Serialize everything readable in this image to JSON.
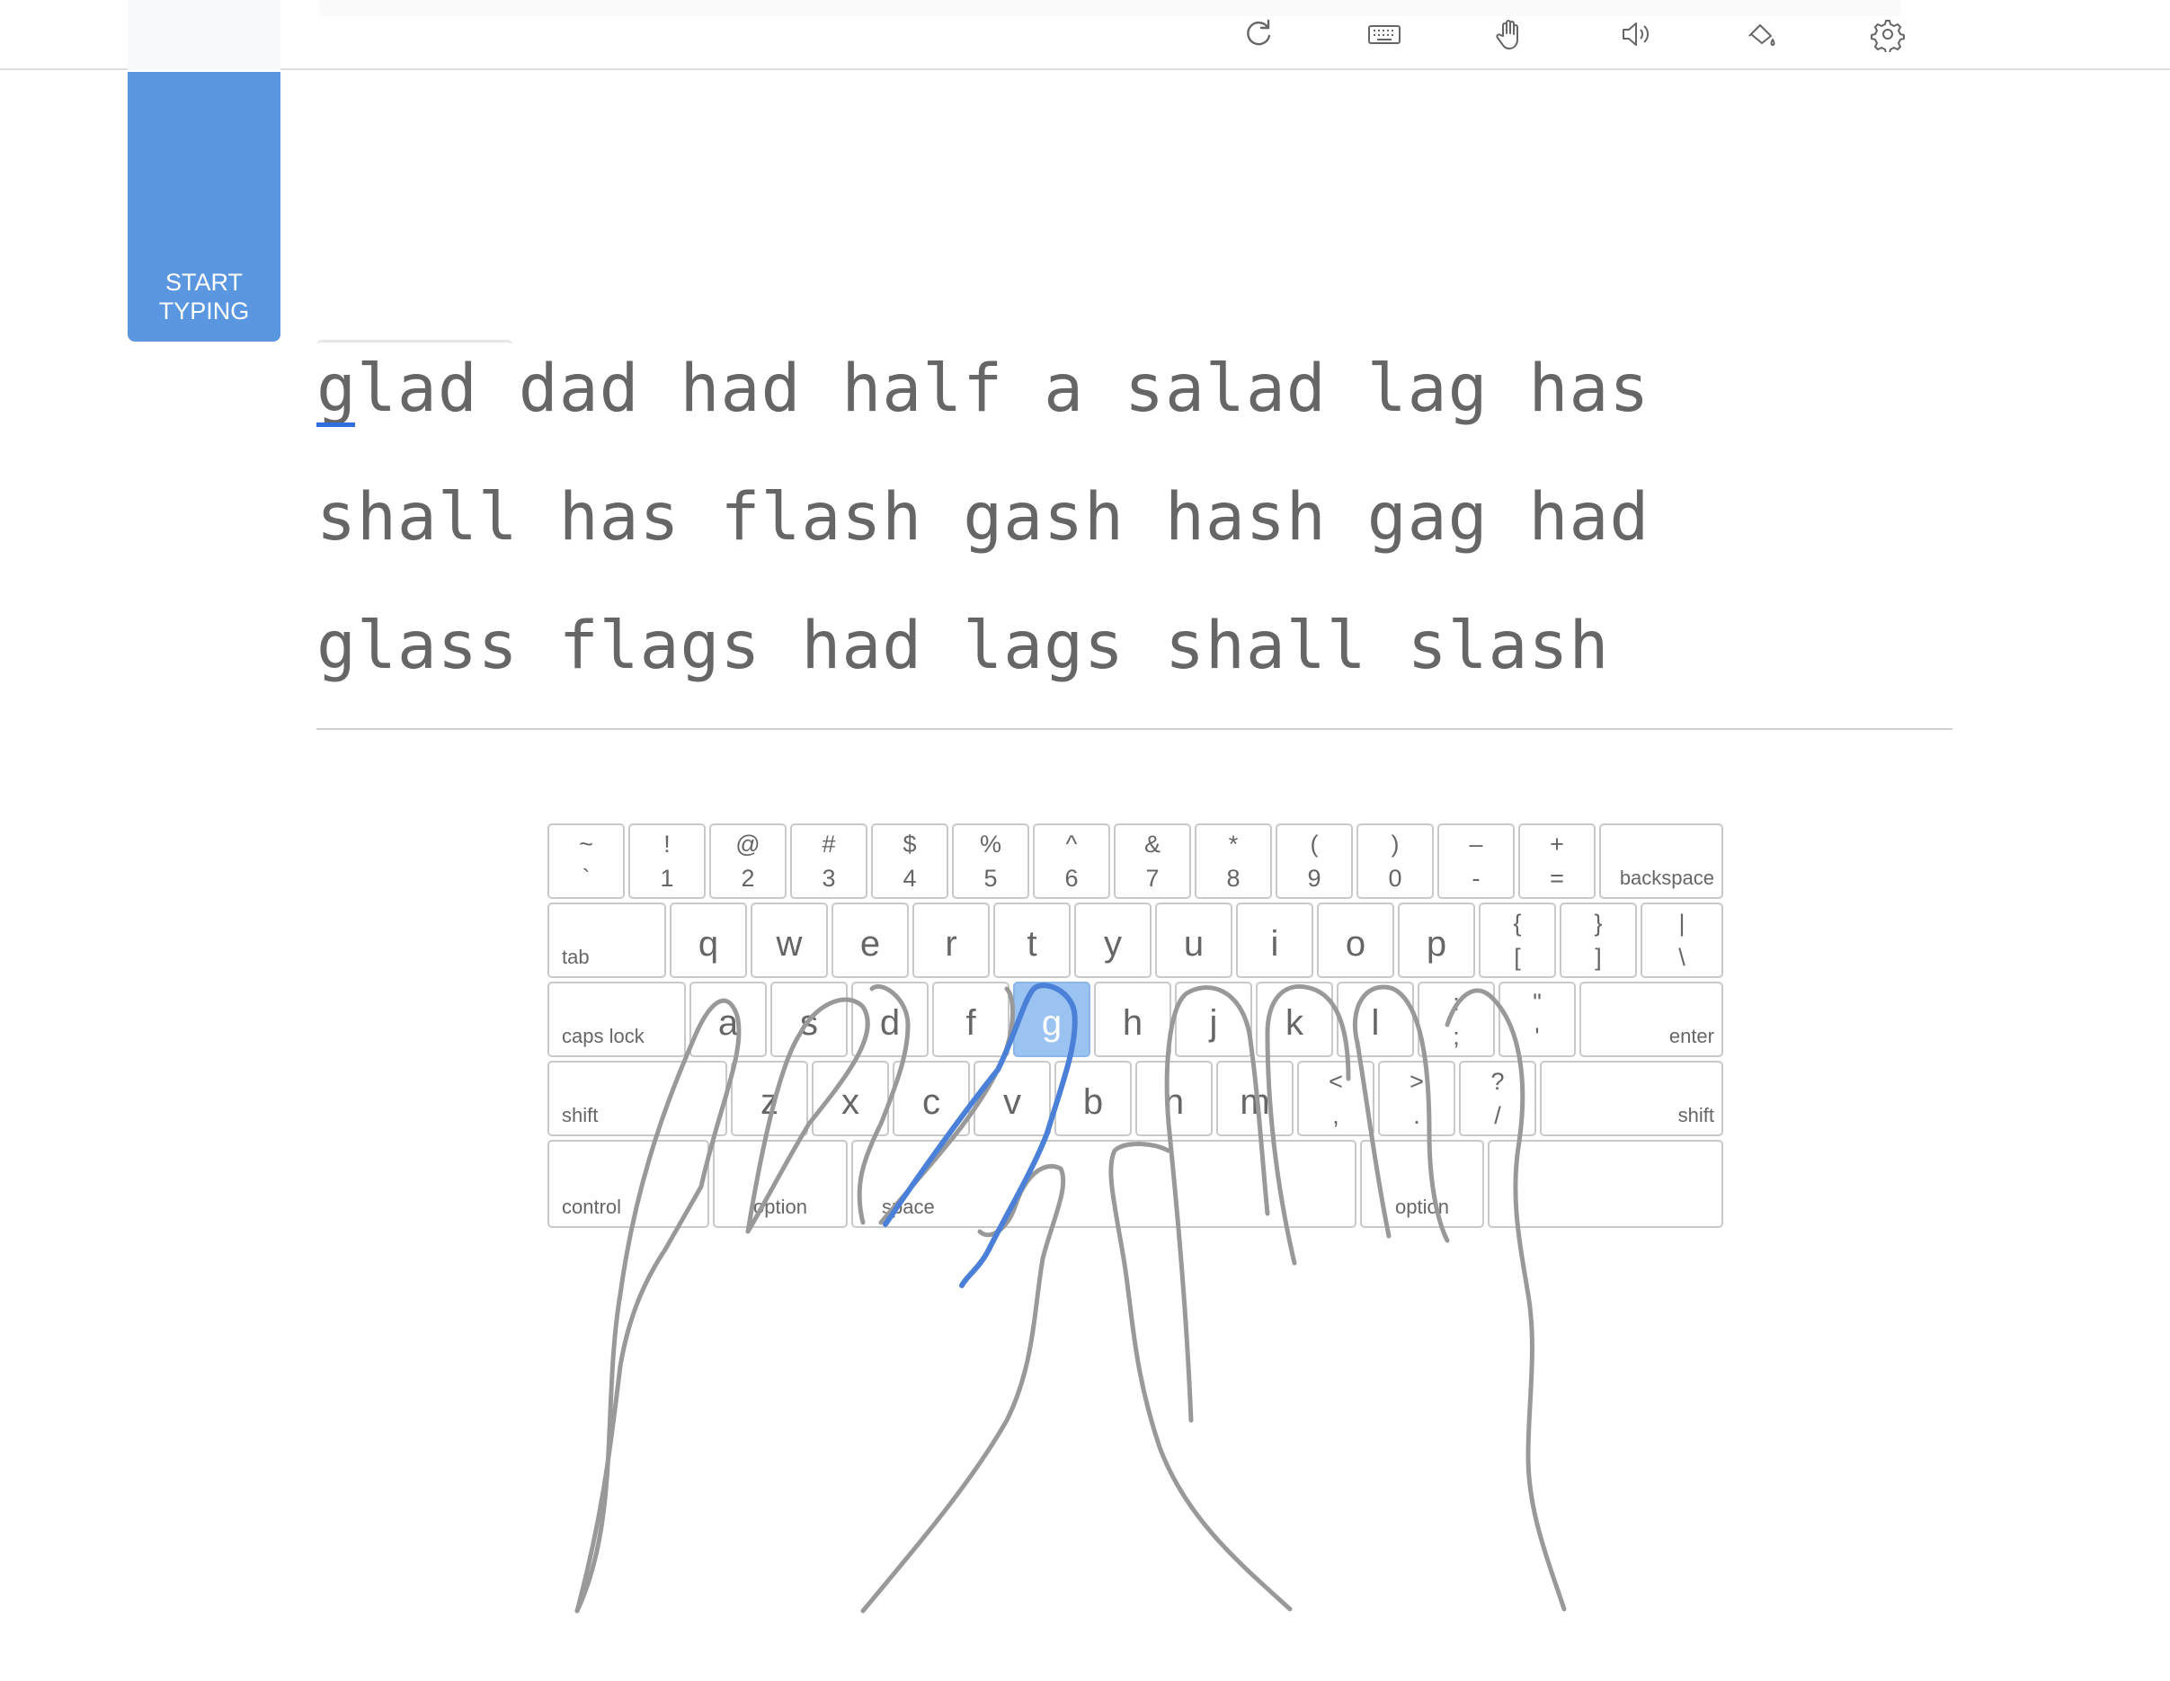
{
  "toolbar": {
    "icons": [
      "refresh-icon",
      "keyboard-icon",
      "hand-icon",
      "sound-icon",
      "paint-bucket-icon",
      "settings-icon"
    ]
  },
  "start_button": {
    "line1": "START",
    "line2": "TYPING",
    "color": "#5b96e0"
  },
  "lesson": {
    "current_char": "g",
    "first_word_rest": "lad dad had half a salad lag has",
    "line2": "shall has flash gash hash gag had",
    "line3": "glass flags had lags shall slash"
  },
  "keyboard": {
    "active_key": "g",
    "active_color": "#9bc3f2",
    "row1": [
      {
        "top": "~",
        "bot": "`"
      },
      {
        "top": "!",
        "bot": "1"
      },
      {
        "top": "@",
        "bot": "2"
      },
      {
        "top": "#",
        "bot": "3"
      },
      {
        "top": "$",
        "bot": "4"
      },
      {
        "top": "%",
        "bot": "5"
      },
      {
        "top": "^",
        "bot": "6"
      },
      {
        "top": "&",
        "bot": "7"
      },
      {
        "top": "*",
        "bot": "8"
      },
      {
        "top": "(",
        "bot": "9"
      },
      {
        "top": ")",
        "bot": "0"
      },
      {
        "top": "–",
        "bot": "-"
      },
      {
        "top": "+",
        "bot": "="
      }
    ],
    "backspace": "backspace",
    "tab": "tab",
    "row2": [
      "q",
      "w",
      "e",
      "r",
      "t",
      "y",
      "u",
      "i",
      "o",
      "p"
    ],
    "row2_sym": [
      {
        "top": "{",
        "bot": "["
      },
      {
        "top": "}",
        "bot": "]"
      },
      {
        "top": "|",
        "bot": "\\"
      }
    ],
    "caps": "caps lock",
    "row3": [
      "a",
      "s",
      "d",
      "f",
      "g",
      "h",
      "j",
      "k",
      "l"
    ],
    "row3_sym": [
      {
        "top": ":",
        "bot": ";"
      },
      {
        "top": "\"",
        "bot": "'"
      }
    ],
    "enter": "enter",
    "shift_left": "shift",
    "row4": [
      "z",
      "x",
      "c",
      "v",
      "b",
      "n",
      "m"
    ],
    "row4_sym": [
      {
        "top": "<",
        "bot": ","
      },
      {
        "top": ">",
        "bot": "."
      },
      {
        "top": "?",
        "bot": "/"
      }
    ],
    "shift_right": "shift",
    "control": "control",
    "option_left": "option",
    "space": "space",
    "option_right": "option"
  }
}
